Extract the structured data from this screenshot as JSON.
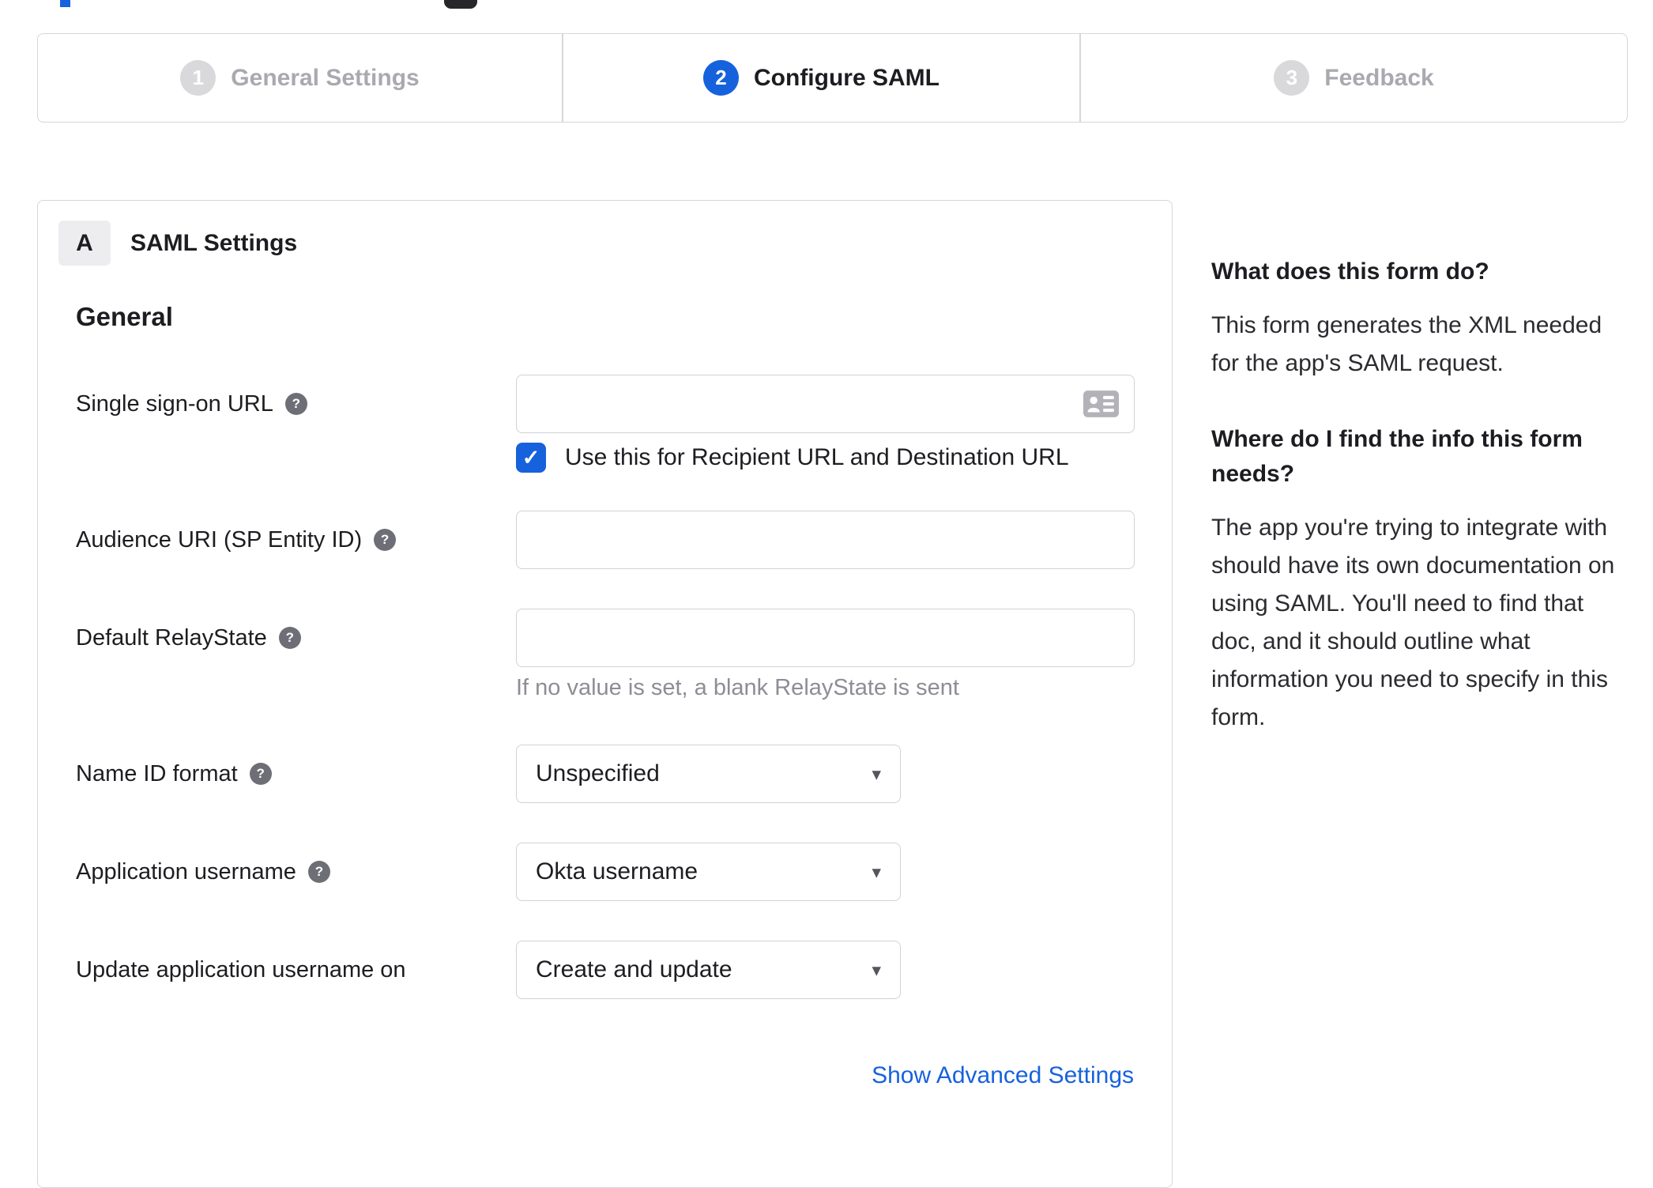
{
  "page": {
    "accent_color": "#1662dd",
    "border_color": "#d7d7db"
  },
  "icons": {
    "help_glyph": "?",
    "checkbox_check": "✓",
    "dropdown_arrow": "▾"
  },
  "stepper": {
    "steps": [
      {
        "number": "1",
        "label": "General Settings",
        "state": "inactive"
      },
      {
        "number": "2",
        "label": "Configure SAML",
        "state": "active"
      },
      {
        "number": "3",
        "label": "Feedback",
        "state": "inactive"
      }
    ]
  },
  "form_card": {
    "section_badge": "A",
    "section_title": "SAML Settings",
    "group_heading": "General",
    "fields": [
      {
        "label": "Single sign-on URL",
        "value": "",
        "checkbox": {
          "checked": true,
          "label": "Use this for Recipient URL and Destination URL"
        }
      },
      {
        "label": "Audience URI (SP Entity ID)",
        "value": ""
      },
      {
        "label": "Default RelayState",
        "value": "",
        "helper": "If no value is set, a blank RelayState is sent"
      },
      {
        "label": "Name ID format",
        "value": "Unspecified"
      },
      {
        "label": "Application username",
        "value": "Okta username"
      },
      {
        "label": "Update application username on",
        "value": "Create and update"
      }
    ],
    "show_advanced_label": "Show Advanced Settings"
  },
  "help_panel": {
    "heading_1": "What does this form do?",
    "body_1": "This form generates the XML needed\nfor the app's SAML request.",
    "heading_2": "Where do I find the info this form\nneeds?",
    "body_2": "The app you're trying to integrate with\nshould have its own documentation on\nusing SAML. You'll need to find that\ndoc, and it should outline what\ninformation you need to specify in this\nform."
  }
}
